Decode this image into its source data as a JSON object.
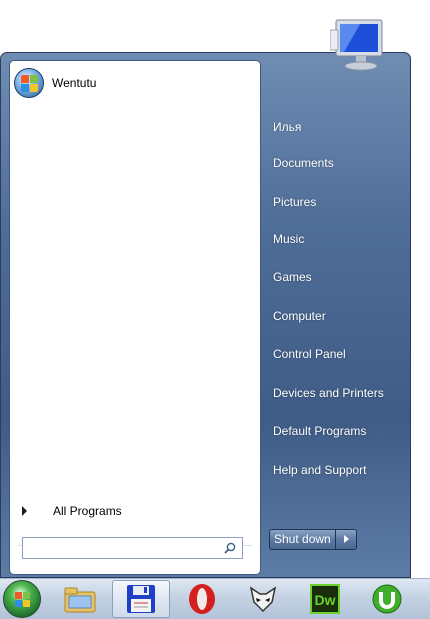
{
  "start_menu": {
    "pinned": [
      {
        "label": "Wentutu",
        "icon": "windows-orb-icon"
      }
    ],
    "all_programs_label": "All Programs",
    "search": {
      "value": "",
      "placeholder": ""
    },
    "right_items": [
      {
        "label": "Илья"
      },
      {
        "label": "Documents"
      },
      {
        "label": "Pictures"
      },
      {
        "label": "Music"
      },
      {
        "label": "Games"
      },
      {
        "label": "Computer"
      },
      {
        "label": "Control Panel"
      },
      {
        "label": "Devices and Printers"
      },
      {
        "label": "Default Programs"
      },
      {
        "label": "Help and Support"
      }
    ],
    "shutdown_label": "Shut down",
    "user_tile_icon": "monitor-icon"
  },
  "taskbar": {
    "start_icon": "windows-start-orb-icon",
    "items": [
      {
        "icon": "windows-explorer-icon"
      },
      {
        "icon": "floppy-save-icon",
        "active": true
      },
      {
        "icon": "opera-icon"
      },
      {
        "icon": "foxtrot-mask-icon"
      },
      {
        "icon": "dreamweaver-icon",
        "text": "Dw"
      },
      {
        "icon": "utorrent-icon"
      }
    ]
  },
  "colors": {
    "menu_blue": "#4d6c96",
    "dreamweaver_green": "#6ad12d",
    "utorrent_green": "#3fae2a",
    "opera_red": "#d41f1f",
    "floppy_blue": "#1e3fc7"
  }
}
